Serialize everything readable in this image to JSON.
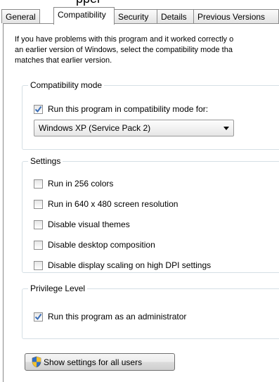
{
  "window_title_fragment": "pper",
  "tabs": [
    "General",
    "Compatibility",
    "Security",
    "Details",
    "Previous Versions"
  ],
  "intro_lines": [
    "If you have problems with this program and it worked correctly o",
    "an earlier version of Windows, select the compatibility mode tha",
    "matches that earlier version."
  ],
  "compat_mode": {
    "title": "Compatibility mode",
    "checkbox_label": "Run this program in compatibility mode for:",
    "checked": true,
    "selected_value": "Windows XP (Service Pack 2)"
  },
  "settings": {
    "title": "Settings",
    "items": [
      {
        "label": "Run in 256 colors",
        "checked": false
      },
      {
        "label": "Run in 640 x 480 screen resolution",
        "checked": false
      },
      {
        "label": "Disable visual themes",
        "checked": false
      },
      {
        "label": "Disable desktop composition",
        "checked": false
      },
      {
        "label": "Disable display scaling on high DPI settings",
        "checked": false
      }
    ]
  },
  "privilege": {
    "title": "Privilege Level",
    "checkbox_label": "Run this program as an administrator",
    "checked": true
  },
  "footer_button": "Show settings for all users",
  "colors": {
    "checkmark": "#3c6fb8",
    "groupbox_border": "#d5dfe5",
    "shield_blue": "#2f6fc8",
    "shield_yellow": "#f2c12e"
  }
}
